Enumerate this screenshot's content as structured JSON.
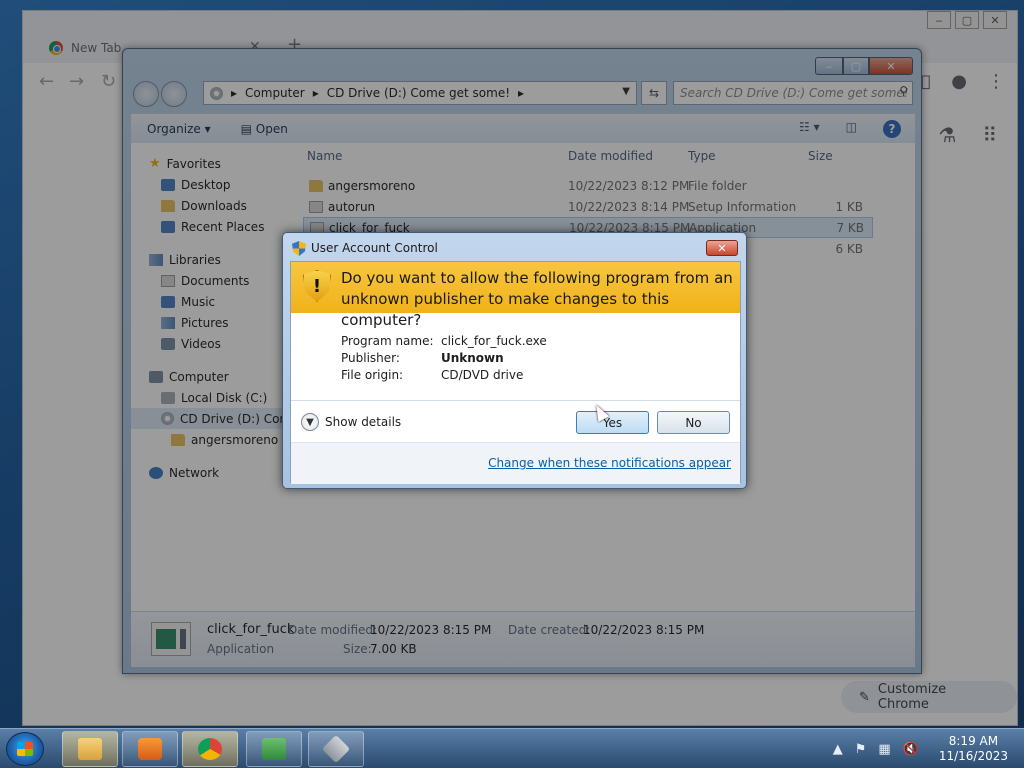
{
  "chrome": {
    "tab_title": "New Tab",
    "tab_close": "✕",
    "new_tab": "+",
    "customize_label": "Customize Chrome",
    "nav_icons": {
      "back": "back-arrow-icon",
      "forward": "forward-arrow-icon",
      "reload": "reload-icon"
    }
  },
  "explorer": {
    "breadcrumb": [
      "Computer",
      "CD Drive (D:) Come get some!"
    ],
    "search_placeholder": "Search CD Drive (D:) Come get some!",
    "toolbar": {
      "organize": "Organize",
      "open": "Open"
    },
    "nav": {
      "favorites": {
        "label": "Favorites",
        "items": [
          "Desktop",
          "Downloads",
          "Recent Places"
        ]
      },
      "libraries": {
        "label": "Libraries",
        "items": [
          "Documents",
          "Music",
          "Pictures",
          "Videos"
        ]
      },
      "computer": {
        "label": "Computer",
        "items": [
          "Local Disk (C:)",
          "CD Drive (D:) Come get some!"
        ],
        "subitem": "angersmoreno"
      },
      "network": {
        "label": "Network"
      }
    },
    "columns": {
      "name": "Name",
      "date": "Date modified",
      "type": "Type",
      "size": "Size"
    },
    "files": [
      {
        "name": "angersmoreno",
        "date": "10/22/2023 8:12 PM",
        "type": "File folder",
        "size": ""
      },
      {
        "name": "autorun",
        "date": "10/22/2023 8:14 PM",
        "type": "Setup Information",
        "size": "1 KB"
      },
      {
        "name": "click_for_fuck",
        "date": "10/22/2023 8:15 PM",
        "type": "Application",
        "size": "7 KB"
      },
      {
        "name": "",
        "date": "",
        "type": "",
        "size": "6 KB"
      }
    ],
    "details": {
      "name": "click_for_fuck",
      "type": "Application",
      "modified_label": "Date modified:",
      "modified": "10/22/2023 8:15 PM",
      "created_label": "Date created:",
      "created": "10/22/2023 8:15 PM",
      "size_label": "Size:",
      "size": "7.00 KB"
    }
  },
  "uac": {
    "title": "User Account Control",
    "question": "Do you want to allow the following program from an unknown publisher to make changes to this computer?",
    "program_label": "Program name:",
    "program_value": "click_for_fuck.exe",
    "publisher_label": "Publisher:",
    "publisher_value": "Unknown",
    "origin_label": "File origin:",
    "origin_value": "CD/DVD drive",
    "show_details": "Show details",
    "yes": "Yes",
    "no": "No",
    "change_link": "Change when these notifications appear",
    "close": "✕"
  },
  "taskbar": {
    "time": "8:19 AM",
    "date": "11/16/2023"
  }
}
